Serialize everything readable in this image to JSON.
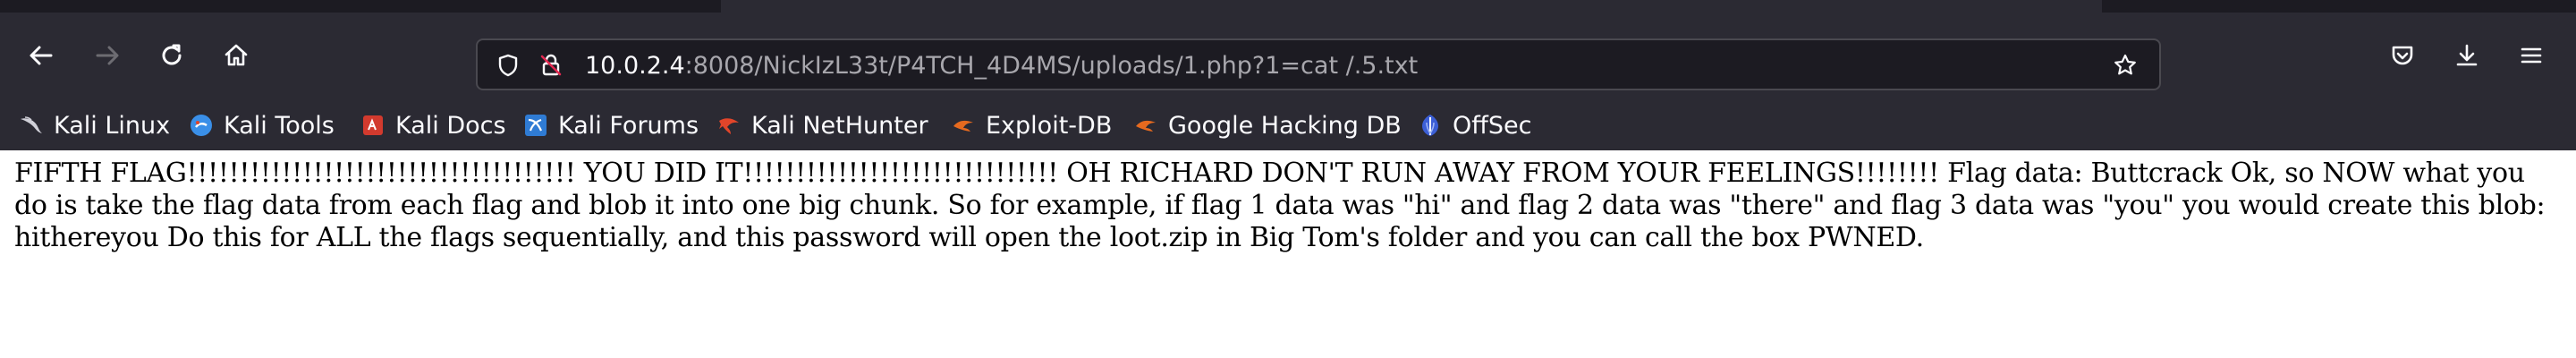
{
  "browser": {
    "url": {
      "host": "10.0.2.4",
      "rest": ":8008/NickIzL33t/P4TCH_4D4MS/uploads/1.php?1=cat /.5.txt"
    },
    "bookmarks": [
      {
        "label": "Kali Linux",
        "icon": "kali-dragon-icon"
      },
      {
        "label": "Kali Tools",
        "icon": "kali-tools-icon"
      },
      {
        "label": "Kali Docs",
        "icon": "kali-docs-icon"
      },
      {
        "label": "Kali Forums",
        "icon": "kali-forums-icon"
      },
      {
        "label": "Kali NetHunter",
        "icon": "kali-nethunter-icon"
      },
      {
        "label": "Exploit-DB",
        "icon": "exploit-db-icon"
      },
      {
        "label": "Google Hacking DB",
        "icon": "ghdb-icon"
      },
      {
        "label": "OffSec",
        "icon": "offsec-icon"
      }
    ],
    "colors": {
      "toolbar": "#2b2a33",
      "urlbar": "#1c1b22",
      "text": "#fbfbfe",
      "dim_text": "#a8a7ad"
    }
  },
  "page": {
    "content": "FIFTH FLAG!!!!!!!!!!!!!!!!!!!!!!!!!!!!!!!!!!!!! YOU DID IT!!!!!!!!!!!!!!!!!!!!!!!!!!!!!! OH RICHARD DON'T RUN AWAY FROM YOUR FEELINGS!!!!!!!! Flag data: Buttcrack Ok, so NOW what you do is take the flag data from each flag and blob it into one big chunk. So for example, if flag 1 data was \"hi\" and flag 2 data was \"there\" and flag 3 data was \"you\" you would create this blob: hithereyou Do this for ALL the flags sequentially, and this password will open the loot.zip in Big Tom's folder and you can call the box PWNED."
  }
}
